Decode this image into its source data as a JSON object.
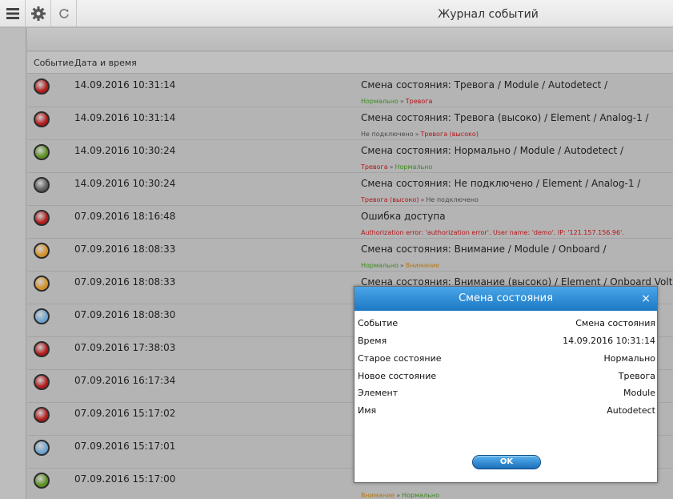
{
  "app": {
    "title": "Журнал событий"
  },
  "toolbar": {
    "icons": [
      "menu-icon",
      "gear-icon",
      "refresh-icon"
    ]
  },
  "table": {
    "headers": {
      "event": "Событие",
      "datetime": "Дата и время"
    },
    "rows": [
      {
        "status_color": "#b11a1a",
        "datetime": "14.09.2016 10:31:14",
        "message": "Смена состояния: Тревога / Module / Autodetect /",
        "old_state": "Нормально",
        "old_color": "#3b8a1f",
        "arrow": "»",
        "new_state": "Тревога",
        "new_color": "#b3151a"
      },
      {
        "status_color": "#b11a1a",
        "datetime": "14.09.2016 10:31:14",
        "message": "Смена состояния: Тревога (высоко) / Element / Analog-1 /",
        "old_state": "Не подключено",
        "old_color": "#4a4a4a",
        "arrow": "»",
        "new_state": "Тревога (высоко)",
        "new_color": "#b3151a"
      },
      {
        "status_color": "#5b8f22",
        "datetime": "14.09.2016 10:30:24",
        "message": "Смена состояния: Нормально / Module / Autodetect /",
        "old_state": "Тревога",
        "old_color": "#b3151a",
        "arrow": "»",
        "new_state": "Нормально",
        "new_color": "#3b8a1f"
      },
      {
        "status_color": "#5c5c5c",
        "datetime": "14.09.2016 10:30:24",
        "message": "Смена состояния: Не подключено / Element / Analog-1 /",
        "old_state": "Тревога (высоко)",
        "old_color": "#b3151a",
        "arrow": "»",
        "new_state": "Не подключено",
        "new_color": "#4a4a4a"
      },
      {
        "status_color": "#b11a1a",
        "datetime": "07.09.2016 18:16:48",
        "message": "Ошибка доступа",
        "old_state": "Authorization error: 'authorization error'. User name: 'demo'. IP: '121.157.156.96'.",
        "old_color": "#b3151a",
        "arrow": "",
        "new_state": "",
        "new_color": "#b3151a"
      },
      {
        "status_color": "#d2912a",
        "datetime": "07.09.2016 18:08:33",
        "message": "Смена состояния: Внимание / Module / Onboard /",
        "old_state": "Нормально",
        "old_color": "#3b8a1f",
        "arrow": "»",
        "new_state": "Внимание",
        "new_color": "#b57812"
      },
      {
        "status_color": "#d2912a",
        "datetime": "07.09.2016 18:08:33",
        "message": "Смена состояния: Внимание (высоко) / Element / Onboard Voltage D",
        "old_state": "",
        "old_color": "#3b8a1f",
        "arrow": "",
        "new_state": "",
        "new_color": "#b57812"
      },
      {
        "status_color": "#6da3cf",
        "datetime": "07.09.2016 18:08:30",
        "message": "",
        "old_state": "",
        "old_color": "#3b8a1f",
        "arrow": "",
        "new_state": "",
        "new_color": "#3b8a1f"
      },
      {
        "status_color": "#b11a1a",
        "datetime": "07.09.2016 17:38:03",
        "message": "",
        "old_state": "",
        "old_color": "#3b8a1f",
        "arrow": "",
        "new_state": "",
        "new_color": "#3b8a1f"
      },
      {
        "status_color": "#b11a1a",
        "datetime": "07.09.2016 16:17:34",
        "message": "",
        "old_state": "",
        "old_color": "#3b8a1f",
        "arrow": "",
        "new_state": "",
        "new_color": "#3b8a1f"
      },
      {
        "status_color": "#b11a1a",
        "datetime": "07.09.2016 15:17:02",
        "message": "",
        "old_state": "",
        "old_color": "#3b8a1f",
        "arrow": "",
        "new_state": "",
        "new_color": "#3b8a1f"
      },
      {
        "status_color": "#6da3cf",
        "datetime": "07.09.2016 15:17:01",
        "message": "",
        "old_state": "",
        "old_color": "#3b8a1f",
        "arrow": "",
        "new_state": "",
        "new_color": "#3b8a1f"
      },
      {
        "status_color": "#5b8f22",
        "datetime": "07.09.2016 15:17:00",
        "message": "",
        "old_state": "Внимание",
        "old_color": "#b57812",
        "arrow": "»",
        "new_state": "Нормально",
        "new_color": "#3b8a1f"
      }
    ]
  },
  "dialog": {
    "title": "Смена состояния",
    "close_icon": "close-icon",
    "fields": [
      {
        "label": "Событие",
        "value": "Смена состояния"
      },
      {
        "label": "Время",
        "value": "14.09.2016 10:31:14"
      },
      {
        "label": "Старое состояние",
        "value": "Нормально"
      },
      {
        "label": "Новое состояние",
        "value": "Тревога"
      },
      {
        "label": "Элемент",
        "value": "Module"
      },
      {
        "label": "Имя",
        "value": "Autodetect"
      }
    ],
    "ok_label": "OK"
  },
  "colors": {
    "accent": "#1c78c3",
    "background": "#b4b4b4"
  }
}
